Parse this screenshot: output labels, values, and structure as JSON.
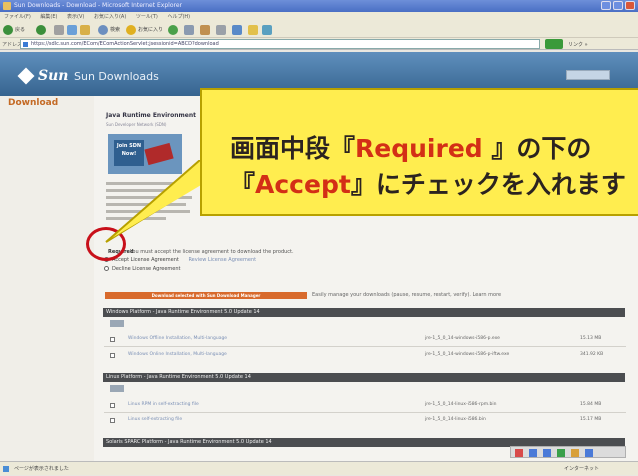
{
  "window": {
    "title": "Sun Downloads - Download - Microsoft Internet Explorer"
  },
  "menubar": [
    "ファイル(F)",
    "編集(E)",
    "表示(V)",
    "お気に入り(A)",
    "ツール(T)",
    "ヘルプ(H)"
  ],
  "toolbar": {
    "back_label": "戻る",
    "search_label": "検索",
    "favorites_label": "お気に入り"
  },
  "address": {
    "label": "アドレス(D)",
    "url": "https://sdlc.sun.com/ECom/EComActionServlet;jsessionid=ABCD?download"
  },
  "header": {
    "logo": "Sun",
    "title": "Sun Downloads"
  },
  "sidebar": {
    "title": "Download"
  },
  "content": {
    "section_title": "Java Runtime Environment",
    "section_subtitle": "Sun Developer Network (SDN)",
    "promo_join": "Join SDN Now!",
    "required_label": "Required",
    "required_text": "You must accept the license agreement to download the product.",
    "accept_label": "Accept License Agreement",
    "review_label": "Review License Agreement",
    "decline_label": "Decline License Agreement",
    "download_button": "Download selected with Sun Download Manager",
    "download_note": "Easily manage your downloads (pause, resume, restart, verify). Learn more",
    "platforms": [
      {
        "header": "Windows Platform - Java Runtime Environment 5.0 Update 14",
        "files": [
          {
            "link": "Windows Offline Installation, Multi-language",
            "file": "jre-1_5_0_14-windows-i586-p.exe",
            "size": "15.13 MB"
          },
          {
            "link": "Windows Online Installation, Multi-language",
            "file": "jre-1_5_0_14-windows-i586-p-iftw.exe",
            "size": "341.92 KB"
          }
        ]
      },
      {
        "header": "Linux Platform - Java Runtime Environment 5.0 Update 14",
        "files": [
          {
            "link": "Linux RPM in self-extracting file",
            "file": "jre-1_5_0_14-linux-i586-rpm.bin",
            "size": "15.84 MB"
          },
          {
            "link": "Linux self-extracting file",
            "file": "jre-1_5_0_14-linux-i586.bin",
            "size": "15.17 MB"
          }
        ]
      },
      {
        "header": "Solaris SPARC Platform - Java Runtime Environment 5.0 Update 14",
        "files": []
      }
    ]
  },
  "callout": {
    "line1_pre": "画面中段『",
    "line1_red": "Required",
    "line1_post": " 』の下の",
    "line2_pre": "『",
    "line2_red": "Accept",
    "line2_post": "』にチェックを入れます"
  },
  "statusbar": {
    "text": "ページが表示されました",
    "zone": "インターネット"
  },
  "colors": {
    "callout_bg": "#ffed4f",
    "callout_red": "#d32f16",
    "header_blue": "#4a78a6",
    "circle_red": "#c8101a",
    "download_orange": "#d86a2c"
  }
}
